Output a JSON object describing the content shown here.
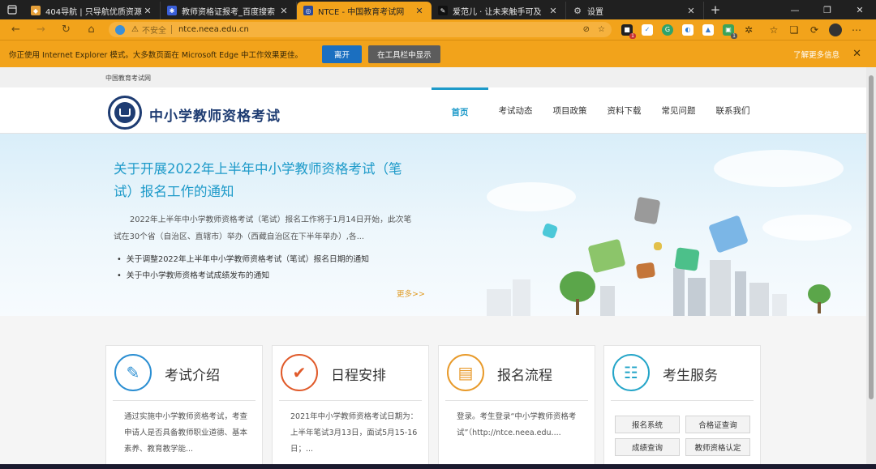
{
  "browser": {
    "tabs": [
      {
        "title": "404导航 | 只导航优质资源!",
        "favicon_color": "#e6a03a",
        "active": false
      },
      {
        "title": "教师资格证报考_百度搜索",
        "favicon_color": "#3a5fd8",
        "active": false
      },
      {
        "title": "NTCE - 中国教育考试网",
        "favicon_color": "#2b4a9a",
        "active": true
      },
      {
        "title": "爱范儿 · 让未来触手可及",
        "favicon_color": "#111111",
        "active": false
      },
      {
        "title": "设置",
        "favicon_color": "#888888",
        "active": false
      }
    ],
    "new_tab_symbol": "+",
    "window_controls": [
      "—",
      "❐",
      "✕"
    ],
    "address": {
      "security_label": "不安全",
      "url": "ntce.neea.edu.cn"
    },
    "accent_color": "#f2a31b"
  },
  "infobar": {
    "message": "你正使用 Internet Explorer 模式。大多数页面在 Microsoft Edge 中工作效果更佳。",
    "leave_button": "离开",
    "show_in_toolbar_button": "在工具栏中显示",
    "learn_more": "了解更多信息"
  },
  "site": {
    "topbar_text": "中国教育考试网",
    "title": "中小学教师资格考试",
    "nav": [
      "首页",
      "考试动态",
      "项目政策",
      "资料下载",
      "常见问题",
      "联系我们"
    ],
    "active_nav": "首页"
  },
  "banner": {
    "headline": "关于开展2022年上半年中小学教师资格考试（笔试）报名工作的通知",
    "body": "2022年上半年中小学教师资格考试（笔试）报名工作将于1月14日开始，此次笔试在30个省（自治区、直辖市）举办（西藏自治区在下半年举办）,各...",
    "links": [
      "关于调整2022年上半年中小学教师资格考试（笔试）报名日期的通知",
      "关于中小学教师资格考试成绩发布的通知"
    ],
    "more": "更多>>"
  },
  "cards": [
    {
      "title": "考试介绍",
      "icon": "book-pen-icon",
      "icon_color": "#2a8ed2",
      "desc": "通过实施中小学教师资格考试，考查申请人是否具备教师职业道德、基本素养、教育教学能..."
    },
    {
      "title": "日程安排",
      "icon": "checkmark-icon",
      "icon_color": "#e05a2a",
      "desc": "2021年中小学教师资格考试日期为：上半年笔试3月13日，面试5月15-16日；..."
    },
    {
      "title": "报名流程",
      "icon": "form-icon",
      "icon_color": "#e89a2a",
      "desc": "登录。考生登录“中小学教师资格考试”（http://ntce.neea.edu...."
    },
    {
      "title": "考生服务",
      "icon": "contact-book-icon",
      "icon_color": "#24a5c8",
      "buttons": [
        "报名系统",
        "合格证查询",
        "成绩查询",
        "教师资格认定"
      ]
    }
  ]
}
